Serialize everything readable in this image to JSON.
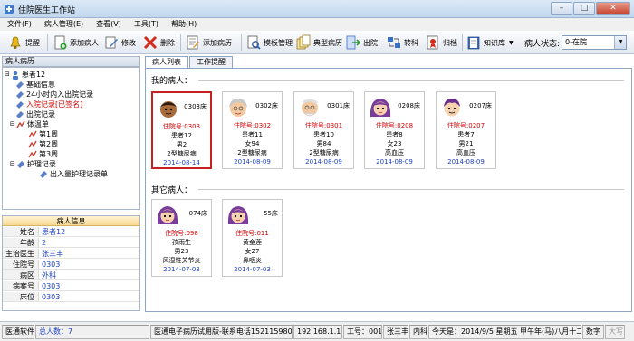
{
  "window": {
    "title": "住院医生工作站"
  },
  "menu": [
    "文件(F)",
    "病人管理(E)",
    "查看(V)",
    "工具(T)",
    "帮助(H)"
  ],
  "toolbar": {
    "remind": "提醒",
    "add_patient": "添加病人",
    "edit": "修改",
    "delete": "删除",
    "add_record": "添加病历",
    "template_mgmt": "模板管理",
    "typical_record": "典型病历",
    "discharge": "出院",
    "transfer": "转科",
    "archive": "归档",
    "knowledge": "知识库",
    "status_label": "病人状态:",
    "status_value": "0-在院"
  },
  "left": {
    "header": "病人病历",
    "tree": {
      "root": "患者12",
      "n1": "基础信息",
      "n2": "24小时内入出院记录",
      "n3": "入院记录[已签名]",
      "n4": "出院记录",
      "n5": "体温单",
      "n5a": "第1周",
      "n5b": "第2周",
      "n5c": "第3周",
      "n6": "护理记录",
      "n6a": "出入量护理记录单"
    }
  },
  "info": {
    "title": "病人信息",
    "rows": [
      {
        "k": "姓名",
        "v": "患者12"
      },
      {
        "k": "年龄",
        "v": "2"
      },
      {
        "k": "主治医生",
        "v": "张三丰"
      },
      {
        "k": "住院号",
        "v": "0303"
      },
      {
        "k": "病区",
        "v": "外科"
      },
      {
        "k": "病案号",
        "v": "0303"
      },
      {
        "k": "床位",
        "v": "0303"
      }
    ]
  },
  "tabs": [
    "病人列表",
    "工作提醒"
  ],
  "my_patients_label": "我的病人：",
  "other_patients_label": "其它病人：",
  "my_patients": [
    {
      "bed": "0303床",
      "hosp": "住院号:0303",
      "name": "患者12",
      "sex_age": "男2",
      "diag": "2型糖尿病",
      "date": "2014-08-14",
      "avatar": "boy"
    },
    {
      "bed": "0302床",
      "hosp": "住院号:0302",
      "name": "患者11",
      "sex_age": "女94",
      "diag": "2型糖尿病",
      "date": "2014-08-09",
      "avatar": "grandma"
    },
    {
      "bed": "0301床",
      "hosp": "住院号:0301",
      "name": "患者10",
      "sex_age": "男84",
      "diag": "2型糖尿病",
      "date": "2014-08-09",
      "avatar": "grandpa"
    },
    {
      "bed": "0208床",
      "hosp": "住院号:0208",
      "name": "患者8",
      "sex_age": "女23",
      "diag": "高血压",
      "date": "2014-08-09",
      "avatar": "woman"
    },
    {
      "bed": "0207床",
      "hosp": "住院号:0207",
      "name": "患者7",
      "sex_age": "男21",
      "diag": "高血压",
      "date": "2014-08-09",
      "avatar": "man"
    }
  ],
  "other_patients": [
    {
      "bed": "074床",
      "hosp": "住院号:098",
      "name": "孩雨生",
      "sex_age": "男23",
      "diag": "风湿性关节炎",
      "date": "2014-07-03",
      "avatar": "woman"
    },
    {
      "bed": "55床",
      "hosp": "住院号:011",
      "name": "黄金莲",
      "sex_age": "女27",
      "diag": "鼻咽炎",
      "date": "2014-07-03",
      "avatar": "woman"
    }
  ],
  "status": {
    "app": "医通软件",
    "total": "总人数：7",
    "trial": "医通电子病历试用版-联系电话15211598002",
    "ip": "192.168.1.103",
    "emp": "工号：001",
    "doctor": "张三丰",
    "dept": "内科",
    "date": "今天是：2014/9/5 星期五 甲午年(马)八月十二",
    "num": "数字",
    "caps": "大写"
  },
  "colors": {
    "accent_red": "#d00000",
    "blue": "#1b3fbf"
  }
}
